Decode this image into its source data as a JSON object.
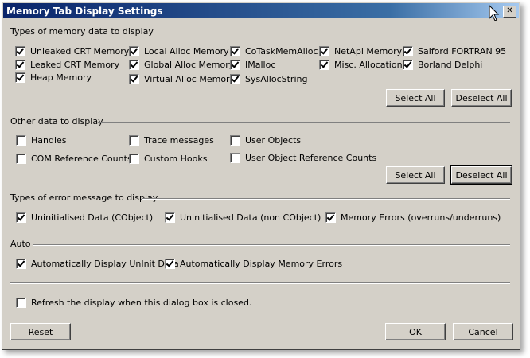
{
  "dialog": {
    "title": "Memory Tab Display Settings",
    "close_glyph": "✕"
  },
  "memory_types": {
    "title": "Types of memory data to display",
    "items": [
      {
        "label": "Unleaked CRT Memory",
        "checked": true
      },
      {
        "label": "Leaked CRT Memory",
        "checked": true
      },
      {
        "label": "Heap Memory",
        "checked": true
      },
      {
        "label": "Local Alloc Memory",
        "checked": true
      },
      {
        "label": "Global Alloc Memory",
        "checked": true
      },
      {
        "label": "Virtual Alloc Memory",
        "checked": true
      },
      {
        "label": "CoTaskMemAlloc",
        "checked": true
      },
      {
        "label": "IMalloc",
        "checked": true
      },
      {
        "label": "SysAllocString",
        "checked": true
      },
      {
        "label": "NetApi Memory",
        "checked": true
      },
      {
        "label": "Misc. Allocations",
        "checked": true
      },
      {
        "label": "Salford FORTRAN 95",
        "checked": true
      },
      {
        "label": "Borland Delphi",
        "checked": true
      }
    ],
    "select_all": "Select All",
    "deselect_all": "Deselect All"
  },
  "other_data": {
    "title": "Other data to display",
    "items": [
      {
        "label": "Handles",
        "checked": false
      },
      {
        "label": "COM Reference Counts",
        "checked": false
      },
      {
        "label": "Trace messages",
        "checked": false
      },
      {
        "label": "Custom Hooks",
        "checked": false
      },
      {
        "label": "User Objects",
        "checked": false
      },
      {
        "label": "User Object Reference Counts",
        "checked": false
      }
    ],
    "select_all": "Select All",
    "deselect_all": "Deselect All"
  },
  "error_types": {
    "title": "Types of error message to display",
    "items": [
      {
        "label": "Uninitialised Data (CObject)",
        "checked": true
      },
      {
        "label": "Uninitialised Data (non CObject)",
        "checked": true
      },
      {
        "label": "Memory Errors (overruns/underruns)",
        "checked": true
      }
    ]
  },
  "auto": {
    "title": "Auto",
    "items": [
      {
        "label": "Automatically Display UnInit Data",
        "checked": true
      },
      {
        "label": "Automatically Display Memory Errors",
        "checked": true
      }
    ]
  },
  "refresh": {
    "label": "Refresh the display when this dialog box is closed.",
    "checked": false
  },
  "buttons": {
    "reset": "Reset",
    "ok": "OK",
    "cancel": "Cancel"
  }
}
